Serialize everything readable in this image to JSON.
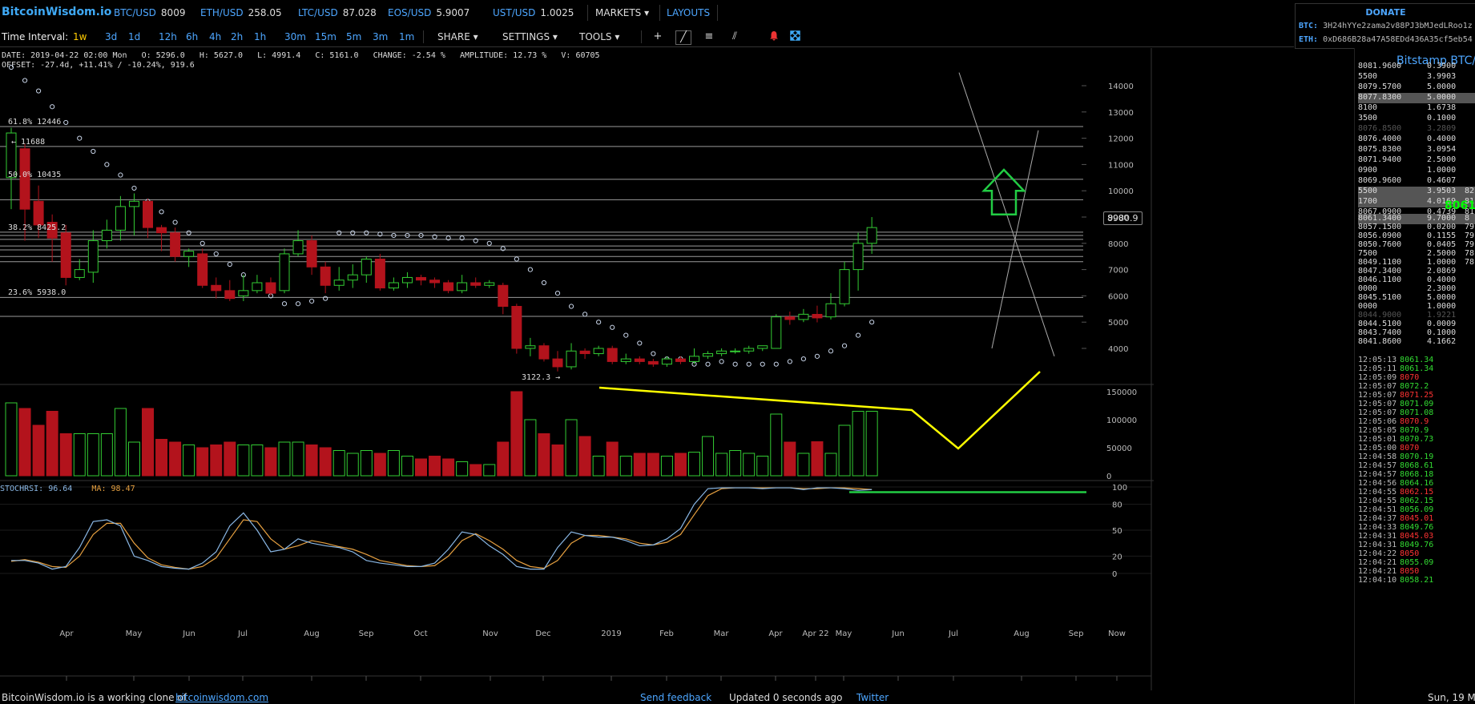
{
  "app": {
    "logo": "BitcoinWisdom.io"
  },
  "tickers": [
    {
      "sym": "BTC/USD",
      "val": "8009"
    },
    {
      "sym": "ETH/USD",
      "val": "258.05"
    },
    {
      "sym": "LTC/USD",
      "val": "87.028"
    },
    {
      "sym": "EOS/USD",
      "val": "5.9007"
    },
    {
      "sym": "UST/USD",
      "val": "1.0025"
    }
  ],
  "menus": {
    "markets": "MARKETS",
    "layouts": "LAYOUTS"
  },
  "donate": {
    "title": "DONATE",
    "btc_label": "BTC:",
    "btc_addr": "3H24hYYe2zama2v88PJ3bMJedLRoo1z",
    "eth_label": "ETH:",
    "eth_addr": "0xD686B28a47A58EDd436A35cf5eb54"
  },
  "toolbar": {
    "interval_label": "Time Interval:",
    "intervals": [
      "1w",
      "3d",
      "1d",
      "12h",
      "6h",
      "4h",
      "2h",
      "1h",
      "30m",
      "15m",
      "5m",
      "3m",
      "1m"
    ],
    "selected_interval": "1w",
    "share": "SHARE",
    "settings": "SETTINGS",
    "tools": "TOOLS",
    "tool_icons": [
      "crosshair-icon",
      "line-draw-icon",
      "hlines-icon",
      "fib-draw-icon",
      "alert-bell-icon",
      "fullscreen-icon"
    ]
  },
  "info": {
    "line1": "DATE: 2019-04-22 02:00 Mon   O: 5296.0   H: 5627.0   L: 4991.4   C: 5161.0   CHANGE: -2.54 %   AMPLITUDE: 12.73 %   V: 60705",
    "line2": "OFFSET: -27.4d, +11.41% / -10.24%, 919.6"
  },
  "chart_data": {
    "type": "candlestick",
    "price_axis": {
      "ticks": [
        "14000",
        "13000",
        "12000",
        "11000",
        "10000",
        "9000",
        "8000",
        "7000",
        "6000",
        "5000",
        "4000"
      ],
      "current_label": "8980.9"
    },
    "volume_axis": {
      "ticks": [
        "150000",
        "100000",
        "50000",
        "0"
      ]
    },
    "rsi_axis": {
      "ticks": [
        "100",
        "80",
        "50",
        "20",
        "0"
      ]
    },
    "x_ticks": [
      "Apr",
      "May",
      "Jun",
      "Jul",
      "Aug",
      "Sep",
      "Oct",
      "Nov",
      "Dec",
      "2019",
      "Feb",
      "Mar",
      "Apr",
      "Apr 22",
      "May",
      "Jun",
      "Jul",
      "Aug",
      "Sep",
      "Now"
    ],
    "fib_labels": [
      {
        "text": "61.8% 12446"
      },
      {
        "text": "← 11688"
      },
      {
        "text": "50.0% 10435"
      },
      {
        "text": "38.2% 8425.2"
      },
      {
        "text": "23.6% 5938.0"
      }
    ],
    "low_label": "3122.3 →",
    "indicator": {
      "name": "STOCHRSI:",
      "value": "96.64",
      "ma_name": "MA:",
      "ma_value": "98.47"
    },
    "candles": [
      {
        "o": 10500,
        "c": 12200,
        "h": 12400,
        "l": 9300
      },
      {
        "o": 11600,
        "c": 9300,
        "h": 11800,
        "l": 8100
      },
      {
        "o": 9600,
        "c": 8700,
        "h": 10200,
        "l": 8200
      },
      {
        "o": 8800,
        "c": 8200,
        "h": 9100,
        "l": 7300
      },
      {
        "o": 8400,
        "c": 6700,
        "h": 8700,
        "l": 6400
      },
      {
        "o": 6700,
        "c": 7000,
        "h": 7400,
        "l": 6600
      },
      {
        "o": 6900,
        "c": 8100,
        "h": 8500,
        "l": 6500
      },
      {
        "o": 8100,
        "c": 8500,
        "h": 8900,
        "l": 7800
      },
      {
        "o": 8500,
        "c": 9400,
        "h": 9800,
        "l": 8100
      },
      {
        "o": 9400,
        "c": 9600,
        "h": 9900,
        "l": 8300
      },
      {
        "o": 9600,
        "c": 8600,
        "h": 9700,
        "l": 8200
      },
      {
        "o": 8600,
        "c": 8400,
        "h": 8700,
        "l": 7700
      },
      {
        "o": 8400,
        "c": 7500,
        "h": 8600,
        "l": 7300
      },
      {
        "o": 7500,
        "c": 7700,
        "h": 7800,
        "l": 7100
      },
      {
        "o": 7600,
        "c": 6400,
        "h": 7800,
        "l": 6300
      },
      {
        "o": 6400,
        "c": 6200,
        "h": 6700,
        "l": 5900
      },
      {
        "o": 6200,
        "c": 5900,
        "h": 6600,
        "l": 5800
      },
      {
        "o": 6000,
        "c": 6200,
        "h": 6800,
        "l": 5800
      },
      {
        "o": 6200,
        "c": 6500,
        "h": 6800,
        "l": 6100
      },
      {
        "o": 6500,
        "c": 6100,
        "h": 6700,
        "l": 6000
      },
      {
        "o": 6200,
        "c": 7600,
        "h": 7800,
        "l": 6100
      },
      {
        "o": 7600,
        "c": 8100,
        "h": 8500,
        "l": 7500
      },
      {
        "o": 8100,
        "c": 7100,
        "h": 8300,
        "l": 6800
      },
      {
        "o": 7100,
        "c": 6400,
        "h": 7300,
        "l": 6100
      },
      {
        "o": 6400,
        "c": 6600,
        "h": 7100,
        "l": 6200
      },
      {
        "o": 6600,
        "c": 6800,
        "h": 7200,
        "l": 6300
      },
      {
        "o": 6800,
        "c": 7400,
        "h": 7500,
        "l": 6500
      },
      {
        "o": 7400,
        "c": 6300,
        "h": 7600,
        "l": 6200
      },
      {
        "o": 6300,
        "c": 6500,
        "h": 6700,
        "l": 6200
      },
      {
        "o": 6500,
        "c": 6700,
        "h": 6900,
        "l": 6300
      },
      {
        "o": 6700,
        "c": 6600,
        "h": 6800,
        "l": 6400
      },
      {
        "o": 6600,
        "c": 6500,
        "h": 6700,
        "l": 6300
      },
      {
        "o": 6500,
        "c": 6200,
        "h": 6600,
        "l": 6100
      },
      {
        "o": 6200,
        "c": 6500,
        "h": 6800,
        "l": 6100
      },
      {
        "o": 6500,
        "c": 6400,
        "h": 6700,
        "l": 6300
      },
      {
        "o": 6400,
        "c": 6500,
        "h": 6600,
        "l": 6300
      },
      {
        "o": 6400,
        "c": 5600,
        "h": 6500,
        "l": 5300
      },
      {
        "o": 5600,
        "c": 4000,
        "h": 5700,
        "l": 3800
      },
      {
        "o": 4000,
        "c": 4100,
        "h": 4400,
        "l": 3700
      },
      {
        "o": 4100,
        "c": 3600,
        "h": 4200,
        "l": 3500
      },
      {
        "o": 3600,
        "c": 3300,
        "h": 3900,
        "l": 3122
      },
      {
        "o": 3300,
        "c": 3900,
        "h": 4200,
        "l": 3200
      },
      {
        "o": 3900,
        "c": 3800,
        "h": 4000,
        "l": 3600
      },
      {
        "o": 3800,
        "c": 4000,
        "h": 4100,
        "l": 3700
      },
      {
        "o": 4000,
        "c": 3500,
        "h": 4100,
        "l": 3400
      },
      {
        "o": 3500,
        "c": 3600,
        "h": 3800,
        "l": 3400
      },
      {
        "o": 3600,
        "c": 3500,
        "h": 3700,
        "l": 3400
      },
      {
        "o": 3500,
        "c": 3400,
        "h": 3600,
        "l": 3300
      },
      {
        "o": 3400,
        "c": 3600,
        "h": 3700,
        "l": 3300
      },
      {
        "o": 3600,
        "c": 3500,
        "h": 3700,
        "l": 3400
      },
      {
        "o": 3500,
        "c": 3700,
        "h": 4000,
        "l": 3400
      },
      {
        "o": 3700,
        "c": 3800,
        "h": 3900,
        "l": 3600
      },
      {
        "o": 3800,
        "c": 3900,
        "h": 4000,
        "l": 3700
      },
      {
        "o": 3900,
        "c": 3900,
        "h": 4000,
        "l": 3800
      },
      {
        "o": 3900,
        "c": 4000,
        "h": 4100,
        "l": 3800
      },
      {
        "o": 4000,
        "c": 4100,
        "h": 4100,
        "l": 3900
      },
      {
        "o": 4000,
        "c": 5200,
        "h": 5300,
        "l": 4000
      },
      {
        "o": 5200,
        "c": 5100,
        "h": 5400,
        "l": 4900
      },
      {
        "o": 5100,
        "c": 5300,
        "h": 5500,
        "l": 5000
      },
      {
        "o": 5296,
        "c": 5161,
        "h": 5627,
        "l": 4991
      },
      {
        "o": 5200,
        "c": 5700,
        "h": 6100,
        "l": 5100
      },
      {
        "o": 5700,
        "c": 7000,
        "h": 7300,
        "l": 5600
      },
      {
        "o": 7000,
        "c": 8000,
        "h": 8400,
        "l": 6200
      },
      {
        "o": 8000,
        "c": 8600,
        "h": 9000,
        "l": 7600
      }
    ],
    "volumes": [
      130000,
      120000,
      90000,
      115000,
      75000,
      75000,
      75000,
      75000,
      120000,
      60000,
      120000,
      65000,
      60000,
      55000,
      50000,
      55000,
      60000,
      55000,
      55000,
      50000,
      60000,
      60000,
      55000,
      50000,
      45000,
      40000,
      45000,
      40000,
      45000,
      35000,
      30000,
      35000,
      30000,
      25000,
      20000,
      20000,
      60000,
      150000,
      100000,
      75000,
      55000,
      100000,
      70000,
      35000,
      60000,
      35000,
      40000,
      40000,
      35000,
      40000,
      42000,
      70000,
      40000,
      45000,
      40000,
      35000,
      110000,
      60000,
      40000,
      60705,
      40000,
      90000,
      115000,
      115000
    ],
    "sar": [
      14700,
      14200,
      13800,
      13200,
      12600,
      12000,
      11500,
      11000,
      10600,
      10100,
      9600,
      9200,
      8800,
      8400,
      8000,
      7600,
      7200,
      6800,
      6400,
      6000,
      5700,
      5700,
      5800,
      5900,
      8400,
      8400,
      8400,
      8350,
      8300,
      8300,
      8300,
      8250,
      8200,
      8200,
      8100,
      8000,
      7800,
      7400,
      7000,
      6500,
      6100,
      5600,
      5300,
      5000,
      4800,
      4500,
      4200,
      3800,
      3600,
      3600,
      3400,
      3400,
      3500,
      3400,
      3400,
      3400,
      3400,
      3500,
      3600,
      3700,
      3900,
      4100,
      4500,
      5000
    ],
    "stoch": [
      15,
      15,
      12,
      5,
      8,
      30,
      60,
      62,
      55,
      20,
      15,
      8,
      6,
      5,
      12,
      25,
      55,
      70,
      50,
      25,
      28,
      40,
      35,
      32,
      30,
      25,
      15,
      12,
      10,
      8,
      8,
      12,
      28,
      48,
      45,
      32,
      22,
      8,
      5,
      5,
      30,
      48,
      44,
      42,
      42,
      38,
      32,
      33,
      40,
      52,
      80,
      98,
      99,
      99,
      99,
      98,
      99,
      99,
      97,
      99,
      99,
      98,
      96,
      97
    ],
    "stoch_ma": [
      14,
      16,
      13,
      8,
      7,
      20,
      45,
      58,
      58,
      35,
      18,
      10,
      7,
      5,
      8,
      18,
      40,
      62,
      60,
      40,
      28,
      32,
      38,
      35,
      31,
      28,
      22,
      15,
      12,
      9,
      8,
      9,
      20,
      38,
      46,
      38,
      28,
      15,
      8,
      6,
      15,
      35,
      44,
      44,
      42,
      40,
      35,
      33,
      36,
      45,
      68,
      90,
      98,
      99,
      99,
      99,
      99,
      99,
      98,
      98,
      99,
      99,
      98,
      97
    ],
    "colors": {
      "up": "#33cc33",
      "down": "#b3131c",
      "grid": "#222222",
      "fib": "#9a9a9a",
      "sar": "#c8d4e8",
      "stoch": "#8ab8e6",
      "stoch_ma": "#e6a040",
      "annotation_yellow": "#ffff00",
      "annotation_green": "#22cc44"
    }
  },
  "orderbook": {
    "title": "Bitstamp BTC/USD",
    "last_price": "8061.34",
    "asks": [
      {
        "p": "8081.9600",
        "q": "0.3900",
        "dim": false,
        "hl": false
      },
      {
        "p": "5500",
        "q": "3.9903",
        "dim": false,
        "hl": false
      },
      {
        "p": "8079.5700",
        "q": "5.0000",
        "dim": false,
        "hl": false
      },
      {
        "p": "8077.8300",
        "q": "5.0000",
        "dim": false,
        "hl": true
      },
      {
        "p": "8100",
        "q": "1.6738",
        "dim": false,
        "hl": false
      },
      {
        "p": "3500",
        "q": "0.1000",
        "dim": false,
        "hl": false
      },
      {
        "p": "8076.8500",
        "q": "3.2809",
        "dim": true,
        "hl": false
      },
      {
        "p": "8076.4000",
        "q": "0.4000",
        "dim": false,
        "hl": false
      },
      {
        "p": "8075.8300",
        "q": "3.0954",
        "dim": false,
        "hl": false
      },
      {
        "p": "8071.9400",
        "q": "2.5000",
        "dim": false,
        "hl": false
      },
      {
        "p": "0900",
        "q": "1.0000",
        "dim": false,
        "hl": false
      },
      {
        "p": "8069.9600",
        "q": "0.4607",
        "dim": false,
        "hl": false
      },
      {
        "p": "5500",
        "q": "3.9503",
        "dim": false,
        "hl": true
      },
      {
        "p": "1700",
        "q": "4.0169",
        "dim": false,
        "hl": true
      },
      {
        "p": "8067.0900",
        "q": "0.4739",
        "dim": false,
        "hl": false
      }
    ],
    "bids": [
      {
        "p": "8061.3400",
        "q": "9.7000",
        "dim": false,
        "hl": true
      },
      {
        "p": "8057.1500",
        "q": "0.0200",
        "dim": false,
        "hl": false
      },
      {
        "p": "8056.0900",
        "q": "0.1155",
        "dim": false,
        "hl": false
      },
      {
        "p": "8050.7600",
        "q": "0.0405",
        "dim": false,
        "hl": false
      },
      {
        "p": "7500",
        "q": "2.5000",
        "dim": false,
        "hl": false
      },
      {
        "p": "8049.1100",
        "q": "1.0000",
        "dim": false,
        "hl": false
      },
      {
        "p": "8047.3400",
        "q": "2.0869",
        "dim": false,
        "hl": false
      },
      {
        "p": "8046.1100",
        "q": "0.4000",
        "dim": false,
        "hl": false
      },
      {
        "p": "0000",
        "q": "2.3000",
        "dim": false,
        "hl": false
      },
      {
        "p": "8045.5100",
        "q": "5.0000",
        "dim": false,
        "hl": false
      },
      {
        "p": "0000",
        "q": "1.0000",
        "dim": false,
        "hl": false
      },
      {
        "p": "8044.9000",
        "q": "1.9221",
        "dim": true,
        "hl": false
      },
      {
        "p": "8044.5100",
        "q": "0.0009",
        "dim": false,
        "hl": false
      },
      {
        "p": "8043.7400",
        "q": "0.1000",
        "dim": false,
        "hl": false
      },
      {
        "p": "8041.8600",
        "q": "4.1662",
        "dim": false,
        "hl": false
      }
    ],
    "right_col": [
      "82",
      "81",
      "81",
      "8",
      "79",
      "79",
      "79",
      "78",
      "78"
    ],
    "trades": [
      {
        "t": "12:05:13",
        "p": "8061.34",
        "side": "buy"
      },
      {
        "t": "12:05:11",
        "p": "8061.34",
        "side": "buy"
      },
      {
        "t": "12:05:09",
        "p": "8070",
        "side": "sell"
      },
      {
        "t": "12:05:07",
        "p": "8072.2",
        "side": "buy"
      },
      {
        "t": "12:05:07",
        "p": "8071.25",
        "side": "sell"
      },
      {
        "t": "12:05:07",
        "p": "8071.09",
        "side": "buy"
      },
      {
        "t": "12:05:07",
        "p": "8071.08",
        "side": "buy"
      },
      {
        "t": "12:05:06",
        "p": "8070.9",
        "side": "sell"
      },
      {
        "t": "12:05:05",
        "p": "8070.9",
        "side": "buy"
      },
      {
        "t": "12:05:01",
        "p": "8070.73",
        "side": "buy"
      },
      {
        "t": "12:05:00",
        "p": "8070",
        "side": "sell"
      },
      {
        "t": "12:04:58",
        "p": "8070.19",
        "side": "buy"
      },
      {
        "t": "12:04:57",
        "p": "8068.61",
        "side": "buy"
      },
      {
        "t": "12:04:57",
        "p": "8068.18",
        "side": "buy"
      },
      {
        "t": "12:04:56",
        "p": "8064.16",
        "side": "buy"
      },
      {
        "t": "12:04:55",
        "p": "8062.15",
        "side": "sell"
      },
      {
        "t": "12:04:55",
        "p": "8062.15",
        "side": "buy"
      },
      {
        "t": "12:04:51",
        "p": "8056.09",
        "side": "buy"
      },
      {
        "t": "12:04:37",
        "p": "8045.01",
        "side": "sell"
      },
      {
        "t": "12:04:33",
        "p": "8049.76",
        "side": "buy"
      },
      {
        "t": "12:04:31",
        "p": "8045.03",
        "side": "sell"
      },
      {
        "t": "12:04:31",
        "p": "8049.76",
        "side": "buy"
      },
      {
        "t": "12:04:22",
        "p": "8050",
        "side": "sell"
      },
      {
        "t": "12:04:21",
        "p": "8055.09",
        "side": "buy"
      },
      {
        "t": "12:04:21",
        "p": "8050",
        "side": "sell"
      },
      {
        "t": "12:04:10",
        "p": "8058.21",
        "side": "buy"
      }
    ]
  },
  "footer": {
    "clone_text": "BitcoinWisdom.io is a working clone of",
    "clone_link": "bitcoinwisdom.com",
    "feedback": "Send feedback",
    "updated": "Updated 0 seconds ago",
    "twitter": "Twitter",
    "date": "Sun, 19 M"
  }
}
